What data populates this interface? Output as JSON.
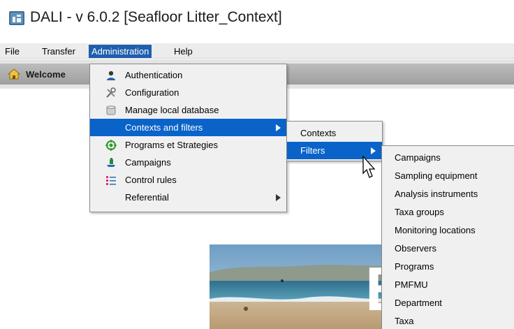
{
  "window": {
    "title": "DALI - v 6.0.2 [Seafloor Litter_Context]"
  },
  "menubar": [
    {
      "label": "File",
      "active": false
    },
    {
      "label": "Transfer",
      "active": false
    },
    {
      "label": "Administration",
      "active": true
    },
    {
      "label": "Help",
      "active": false
    }
  ],
  "toolbar": {
    "welcome_label": "Welcome"
  },
  "admin_menu": [
    {
      "label": "Authentication",
      "icon": "user-icon",
      "submenu": false,
      "highlighted": false
    },
    {
      "label": "Configuration",
      "icon": "tools-icon",
      "submenu": false,
      "highlighted": false
    },
    {
      "label": "Manage local database",
      "icon": "database-icon",
      "submenu": false,
      "highlighted": false
    },
    {
      "label": "Contexts and filters",
      "icon": "",
      "submenu": true,
      "highlighted": true
    },
    {
      "label": "Programs et Strategies",
      "icon": "target-icon",
      "submenu": false,
      "highlighted": false
    },
    {
      "label": "Campaigns",
      "icon": "campaign-icon",
      "submenu": false,
      "highlighted": false
    },
    {
      "label": "Control rules",
      "icon": "rules-icon",
      "submenu": false,
      "highlighted": false
    },
    {
      "label": "Referential",
      "icon": "",
      "submenu": true,
      "highlighted": false
    }
  ],
  "contexts_menu": [
    {
      "label": "Contexts",
      "submenu": false,
      "highlighted": false
    },
    {
      "label": "Filters",
      "submenu": true,
      "highlighted": true
    }
  ],
  "filters_menu": [
    "Campaigns",
    "Sampling equipment",
    "Analysis instruments",
    "Taxa groups",
    "Monitoring locations",
    "Observers",
    "Programs",
    "PMFMU",
    "Department",
    "Taxa"
  ],
  "colors": {
    "highlight": "#0a63c9",
    "menubar_active": "#1e5fae"
  }
}
